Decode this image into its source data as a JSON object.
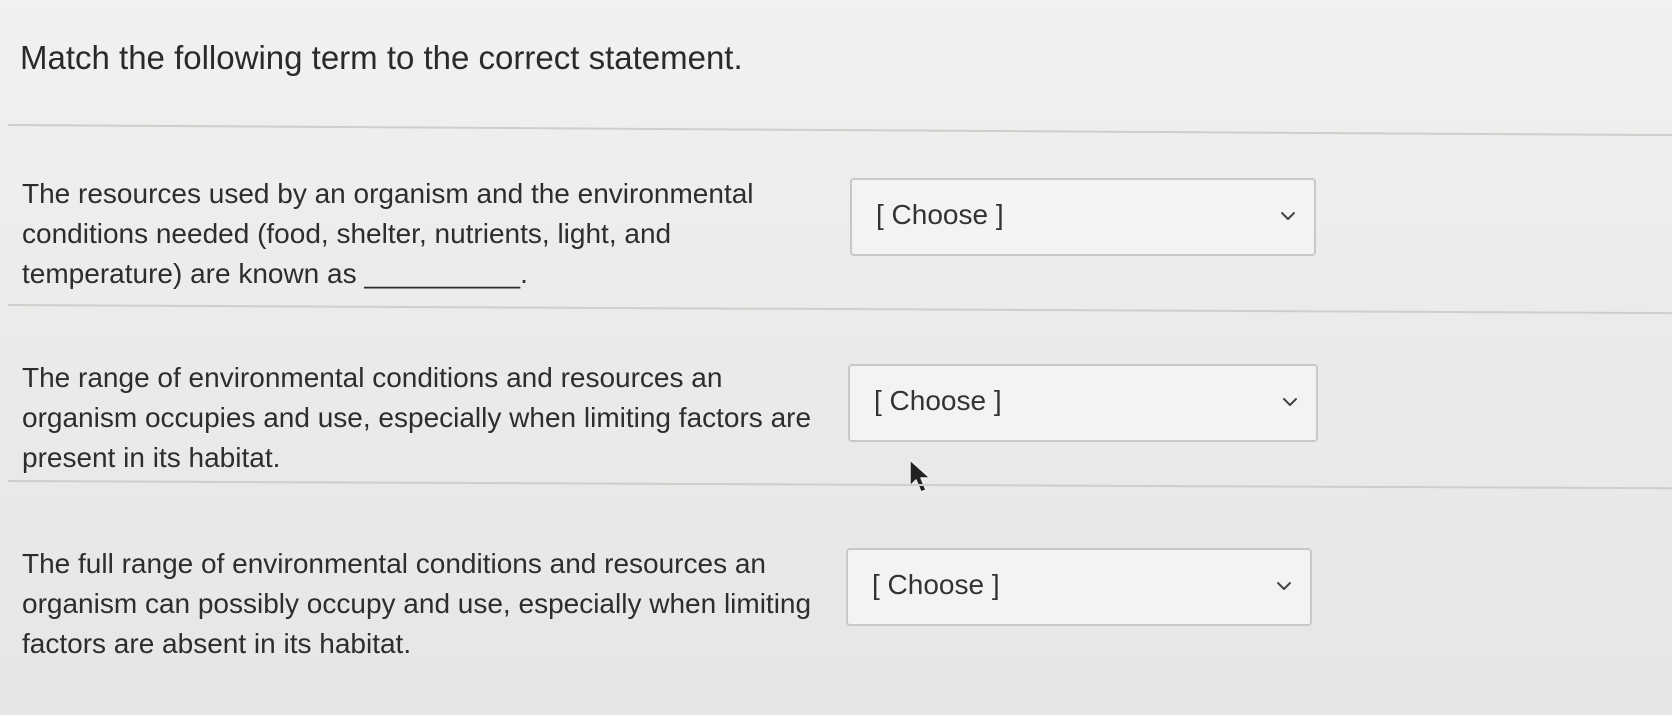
{
  "quiz": {
    "instruction": "Match the following term to the correct statement.",
    "items": [
      {
        "statement": "The resources used by an organism and the environmental conditions needed (food, shelter, nutrients, light, and temperature) are known as __________.",
        "select_value": "[ Choose ]"
      },
      {
        "statement": "The range of environmental conditions and resources an organism occupies and use, especially when limiting factors are present in its habitat.",
        "select_value": "[ Choose ]"
      },
      {
        "statement": "The full range of environmental conditions and resources an organism can possibly occupy and use, especially when limiting factors are absent in its habitat.",
        "select_value": "[ Choose ]"
      }
    ]
  },
  "icons": {
    "dropdown": "chevron-down-icon",
    "pointer": "mouse-cursor-icon"
  },
  "colors": {
    "background": "#ecebe9",
    "text": "#2d2d2d",
    "border": "#c9c8c6"
  }
}
